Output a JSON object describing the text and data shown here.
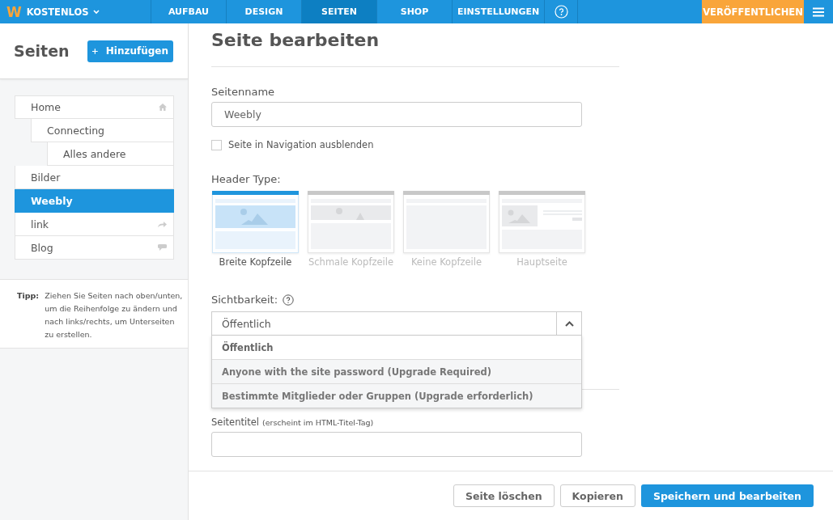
{
  "topbar": {
    "logo": "W",
    "plan": "KOSTENLOS",
    "tabs": [
      {
        "label": "AUFBAU",
        "selected": false
      },
      {
        "label": "DESIGN",
        "selected": false
      },
      {
        "label": "SEITEN",
        "selected": true
      },
      {
        "label": "SHOP",
        "selected": false
      },
      {
        "label": "EINSTELLUNGEN",
        "selected": false
      }
    ],
    "publish": "VERÖFFENTLICHEN"
  },
  "sidebar": {
    "title": "Seiten",
    "add_button": "Hinzufügen",
    "pages": [
      {
        "label": "Home",
        "kind": "home",
        "selected": false,
        "children": [
          {
            "label": "Connecting",
            "selected": false,
            "children": [
              {
                "label": "Alles andere",
                "selected": false
              }
            ]
          }
        ]
      },
      {
        "label": "Bilder",
        "selected": false
      },
      {
        "label": "Weebly",
        "selected": true
      },
      {
        "label": "link",
        "kind": "link",
        "selected": false
      },
      {
        "label": "Blog",
        "kind": "blog",
        "selected": false
      }
    ],
    "tip_label": "Tipp:",
    "tip": "Ziehen Sie Seiten nach oben/unten, um die Reihenfolge zu ändern und nach links/rechts, um Unterseiten zu erstellen."
  },
  "editor": {
    "title": "Seite bearbeiten",
    "name_label": "Seitenname",
    "name_value": "Weebly",
    "hide_checkbox": {
      "label": "Seite in Navigation ausblenden",
      "checked": false
    },
    "header_label": "Header Type:",
    "header_types": [
      {
        "label": "Breite Kopfzeile",
        "kind": "wide",
        "selected": true
      },
      {
        "label": "Schmale Kopfzeile",
        "kind": "narrow",
        "selected": false
      },
      {
        "label": "Keine Kopfzeile",
        "kind": "none",
        "selected": false
      },
      {
        "label": "Hauptseite",
        "kind": "landing",
        "selected": false
      }
    ],
    "visibility_label": "Sichtbarkeit:",
    "visibility_value": "Öffentlich",
    "visibility_options": [
      {
        "label": "Öffentlich",
        "selected": true
      },
      {
        "label": "Anyone with the site password (Upgrade Required)",
        "selected": false
      },
      {
        "label": "Bestimmte Mitglieder oder Gruppen (Upgrade erforderlich)",
        "selected": false
      }
    ],
    "seo_title_label": "Seitentitel",
    "seo_title_hint": "(erscheint im HTML-Titel-Tag)"
  },
  "footer": {
    "buttons": [
      {
        "label": "Seite löschen",
        "kind": "secondary"
      },
      {
        "label": "Kopieren",
        "kind": "secondary"
      },
      {
        "label": "Speichern und bearbeiten",
        "kind": "primary"
      }
    ]
  }
}
